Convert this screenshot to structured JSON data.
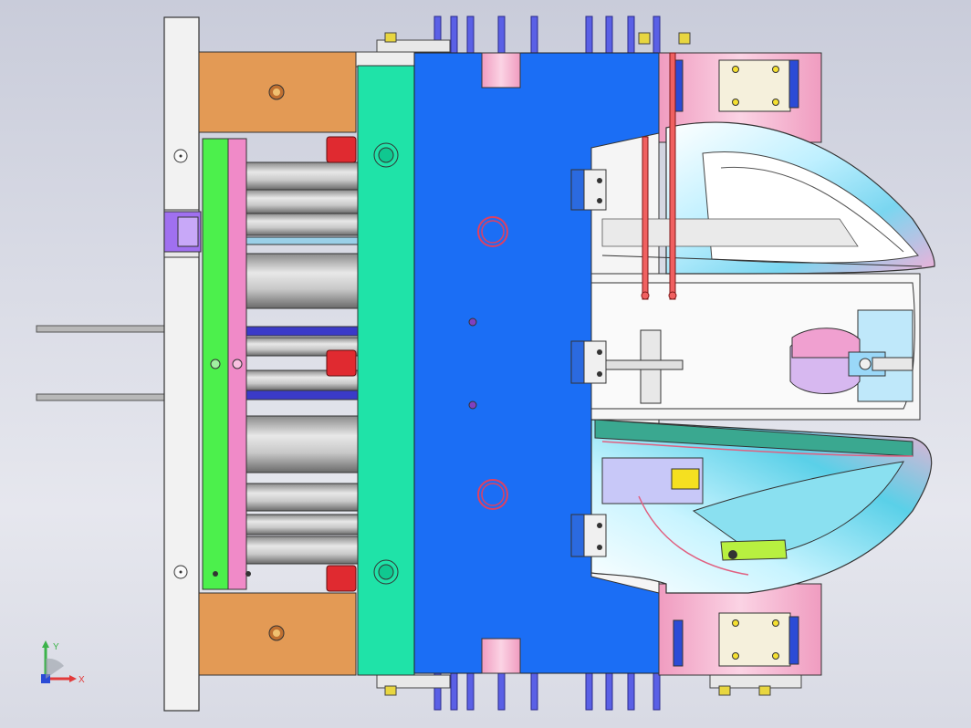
{
  "viewport": {
    "background_top": "#c9ccda",
    "background_bottom": "#e6e7ee"
  },
  "triad": {
    "x_label": "X",
    "y_label": "Y",
    "x_color": "#e23b3b",
    "y_color": "#3bb34a",
    "z_color": "#2b4bd6"
  },
  "colors": {
    "cavity_plate": "#1b6ef5",
    "core_plate": "#1fe3a8",
    "support_block": "#e39a55",
    "ejector_plate_green": "#4cf04c",
    "ejector_plate_pink": "#f08ac8",
    "clamp_plate": "#f0f0f0",
    "guide_pin_cap": "#e02a30",
    "cooling_pipe": "#4a55e0",
    "part_surface": "#b8e8f8"
  }
}
